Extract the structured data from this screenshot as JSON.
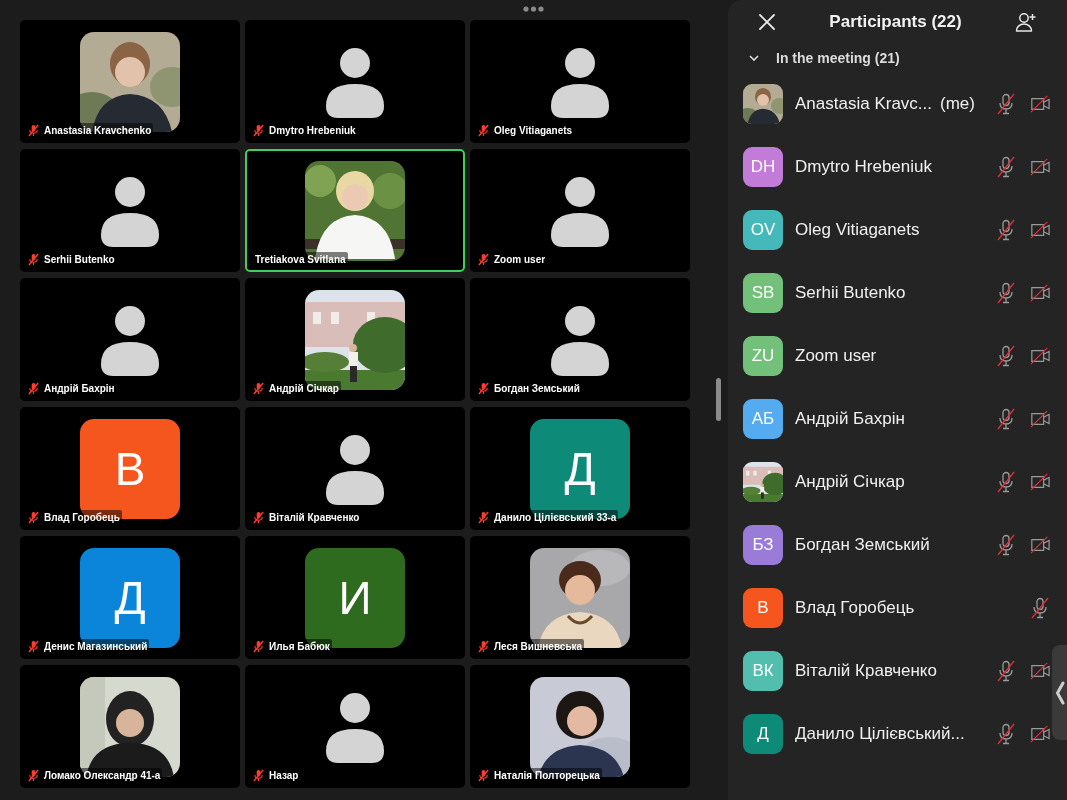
{
  "tiles": [
    {
      "name": "Anastasia Kravchenko",
      "kind": "picture",
      "mic_muted": true,
      "highlighted": false
    },
    {
      "name": "Dmytro Hrebeniuk",
      "kind": "silhouette",
      "mic_muted": true,
      "highlighted": false
    },
    {
      "name": "Oleg Vitiaganets",
      "kind": "silhouette",
      "mic_muted": true,
      "highlighted": false
    },
    {
      "name": "Serhii Butenko",
      "kind": "silhouette",
      "mic_muted": true,
      "highlighted": false
    },
    {
      "name": "Tretiakova Svitlana",
      "kind": "picture",
      "mic_muted": false,
      "highlighted": true
    },
    {
      "name": "Zoom user",
      "kind": "silhouette",
      "mic_muted": true,
      "highlighted": false
    },
    {
      "name": "Андрій Бахрін",
      "kind": "silhouette",
      "mic_muted": true,
      "highlighted": false
    },
    {
      "name": "Андрій Січкар",
      "kind": "picture",
      "mic_muted": true,
      "highlighted": false
    },
    {
      "name": "Богдан Земський",
      "kind": "silhouette",
      "mic_muted": true,
      "highlighted": false
    },
    {
      "name": "Влад Горобець",
      "kind": "letter",
      "letter": "В",
      "color": "#f4561e",
      "mic_muted": true,
      "highlighted": false
    },
    {
      "name": "Віталій Кравченко",
      "kind": "silhouette",
      "mic_muted": true,
      "highlighted": false
    },
    {
      "name": "Данило Цілієвський 33-а",
      "kind": "letter",
      "letter": "Д",
      "color": "#0e8a78",
      "mic_muted": true,
      "highlighted": false
    },
    {
      "name": "Денис Магазинський",
      "kind": "letter",
      "letter": "Д",
      "color": "#0a85d9",
      "mic_muted": true,
      "highlighted": false
    },
    {
      "name": "Илья Бабюк",
      "kind": "letter",
      "letter": "И",
      "color": "#2f6b1f",
      "mic_muted": true,
      "highlighted": false
    },
    {
      "name": "Леся Вишневська",
      "kind": "picture",
      "mic_muted": true,
      "highlighted": false
    },
    {
      "name": "Ломако Олександр 41-а",
      "kind": "picture",
      "mic_muted": true,
      "highlighted": false
    },
    {
      "name": "Назар",
      "kind": "silhouette",
      "mic_muted": true,
      "highlighted": false
    },
    {
      "name": "Наталія Полторецька",
      "kind": "picture",
      "mic_muted": true,
      "highlighted": false
    }
  ],
  "panel": {
    "title": "Participants (22)",
    "section": "In the meeting (21)",
    "section_expanded": true,
    "participants": [
      {
        "name": "Anastasia Kravc...",
        "suffix": "(me)",
        "mic_muted": true,
        "has_camera": true
      },
      {
        "name": "Dmytro Hrebeniuk",
        "avatar": {
          "kind": "initials",
          "initials": "DH",
          "color": "#c27bd6"
        },
        "mic_muted": true,
        "has_camera": true
      },
      {
        "name": "Oleg Vitiaganets",
        "avatar": {
          "kind": "initials",
          "initials": "OV",
          "color": "#45b9b9"
        },
        "mic_muted": true,
        "has_camera": true
      },
      {
        "name": "Serhii Butenko",
        "avatar": {
          "kind": "initials",
          "initials": "SB",
          "color": "#72c07a"
        },
        "mic_muted": true,
        "has_camera": true
      },
      {
        "name": "Zoom user",
        "avatar": {
          "kind": "initials",
          "initials": "ZU",
          "color": "#72c07a"
        },
        "mic_muted": true,
        "has_camera": true
      },
      {
        "name": "Андрій Бахрін",
        "avatar": {
          "kind": "initials",
          "initials": "АБ",
          "color": "#55abf0"
        },
        "mic_muted": true,
        "has_camera": true
      },
      {
        "name": "Андрій Січкар",
        "mic_muted": true,
        "has_camera": true
      },
      {
        "name": "Богдан Земський",
        "avatar": {
          "kind": "initials",
          "initials": "БЗ",
          "color": "#9a7bd8"
        },
        "mic_muted": true,
        "has_camera": true
      },
      {
        "name": "Влад Горобець",
        "avatar": {
          "kind": "initials",
          "initials": "В",
          "color": "#f4561e"
        },
        "mic_muted": true,
        "has_camera": false
      },
      {
        "name": "Віталій Кравченко",
        "avatar": {
          "kind": "initials",
          "initials": "ВК",
          "color": "#52bfae"
        },
        "mic_muted": true,
        "has_camera": true
      },
      {
        "name": "Данило Цілієвський...",
        "avatar": {
          "kind": "initials",
          "initials": "Д",
          "color": "#0e8a78"
        },
        "mic_muted": true,
        "has_camera": true
      }
    ]
  }
}
